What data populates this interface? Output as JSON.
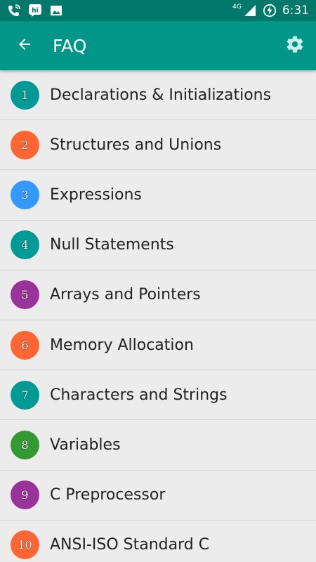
{
  "status_bar": {
    "network": "4G",
    "time": "6:31"
  },
  "app_bar": {
    "title": "FAQ",
    "back_icon": "arrow-back-icon",
    "settings_icon": "gear-icon"
  },
  "colors": {
    "primary": "#009688",
    "primary_dark": "#00796b",
    "teal": "#009a94",
    "orange": "#ff6633",
    "blue": "#3399ff",
    "purple": "#993399",
    "green": "#339933"
  },
  "items": [
    {
      "number": "1",
      "label": "Declarations & Initializations",
      "color": "#009a94"
    },
    {
      "number": "2",
      "label": "Structures and Unions",
      "color": "#ff6633"
    },
    {
      "number": "3",
      "label": "Expressions",
      "color": "#3399ff"
    },
    {
      "number": "4",
      "label": "Null Statements",
      "color": "#009a94"
    },
    {
      "number": "5",
      "label": "Arrays and Pointers",
      "color": "#993399"
    },
    {
      "number": "6",
      "label": "Memory Allocation",
      "color": "#ff6633"
    },
    {
      "number": "7",
      "label": "Characters and Strings",
      "color": "#009a94"
    },
    {
      "number": "8",
      "label": "Variables",
      "color": "#339933"
    },
    {
      "number": "9",
      "label": "C Preprocessor",
      "color": "#993399"
    },
    {
      "number": "10",
      "label": "ANSI-ISO Standard C",
      "color": "#ff6633"
    }
  ]
}
